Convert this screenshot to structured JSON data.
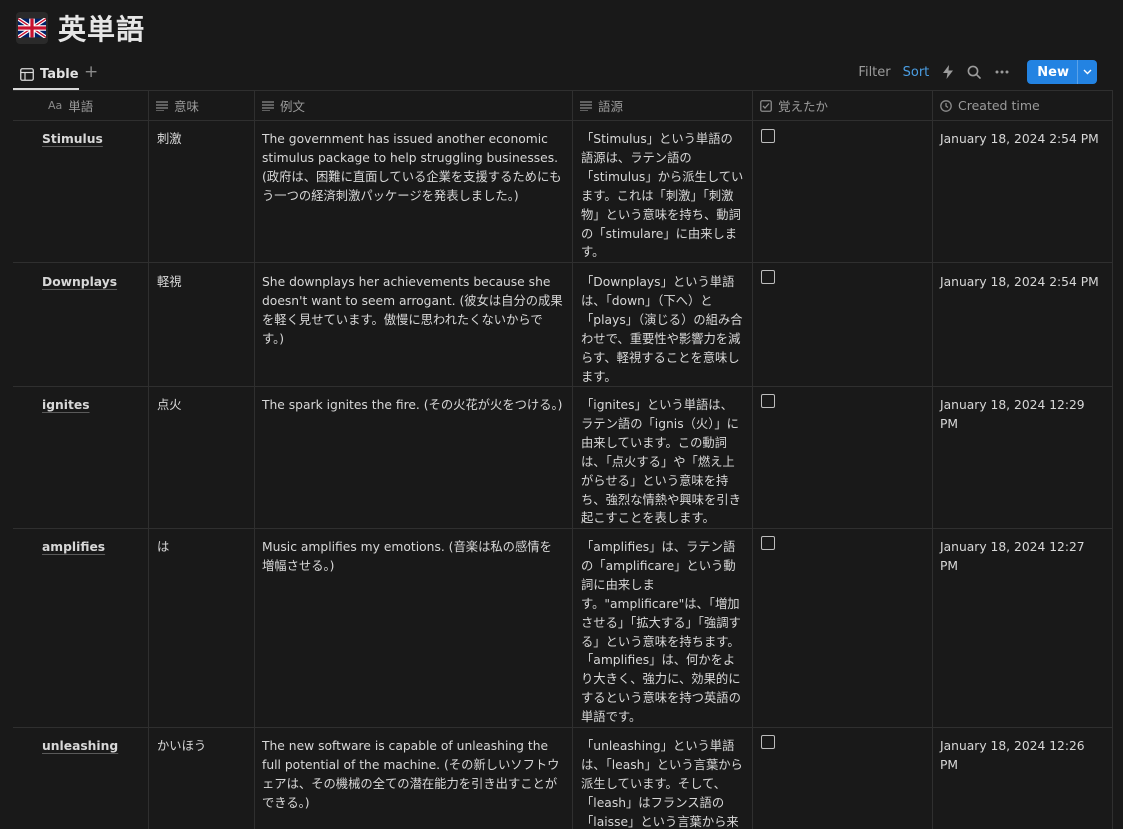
{
  "page": {
    "title": "英単語",
    "icon": "uk-flag-icon"
  },
  "views": {
    "active_tab": "Table",
    "add_label": "+"
  },
  "toolbar": {
    "filter": "Filter",
    "sort": "Sort",
    "new": "New"
  },
  "columns": {
    "word": "単語",
    "word_type_glyph": "Aa",
    "meaning": "意味",
    "example": "例文",
    "etymology": "語源",
    "learned": "覚えたか",
    "created": "Created time"
  },
  "rows": [
    {
      "word": "Stimulus",
      "meaning": "刺激",
      "example": "The government has issued another economic stimulus package to help struggling businesses. (政府は、困難に直面している企業を支援するためにもう一つの経済刺激パッケージを発表しました。)",
      "etymology": "「Stimulus」という単語の語源は、ラテン語の「stimulus」から派生しています。これは「刺激」「刺激物」という意味を持ち、動詞の「stimulare」に由来します。",
      "learned": false,
      "created": "January 18, 2024 2:54 PM"
    },
    {
      "word": "Downplays",
      "meaning": "軽視",
      "example": "She downplays her achievements because she doesn't want to seem arrogant. (彼女は自分の成果を軽く見せています。傲慢に思われたくないからです。)",
      "etymology": "「Downplays」という単語は、「down」（下へ）と「plays」（演じる）の組み合わせで、重要性や影響力を減らす、軽視することを意味します。",
      "learned": false,
      "created": "January 18, 2024 2:54 PM"
    },
    {
      "word": "ignites",
      "meaning": "点火",
      "example": "The spark ignites the fire. (その火花が火をつける。)",
      "etymology": "「ignites」という単語は、ラテン語の「ignis（火）」に由来しています。この動詞は、「点火する」や「燃え上がらせる」という意味を持ち、強烈な情熱や興味を引き起こすことを表します。",
      "learned": false,
      "created": "January 18, 2024 12:29 PM"
    },
    {
      "word": "amplifies",
      "meaning": "は",
      "example": "Music amplifies my emotions. (音楽は私の感情を増幅させる。)",
      "etymology": "「amplifies」は、ラテン語の「amplificare」という動詞に由来します。\"amplificare\"は、「増加させる」「拡大する」「強調する」という意味を持ちます。「amplifies」は、何かをより大きく、強力に、効果的にするという意味を持つ英語の単語です。",
      "learned": false,
      "created": "January 18, 2024 12:27 PM"
    },
    {
      "word": "unleashing",
      "meaning": "かいほう",
      "example": "The new software is capable of unleashing the full potential of the machine. (その新しいソフトウェアは、その機械の全ての潜在能力を引き出すことができる。)",
      "etymology": "「unleashing」という単語は、「leash」という言葉から派生しています。そして、「leash」はフランス語の「laisse」という言葉から来",
      "learned": false,
      "created": "January 18, 2024 12:26 PM"
    }
  ]
}
